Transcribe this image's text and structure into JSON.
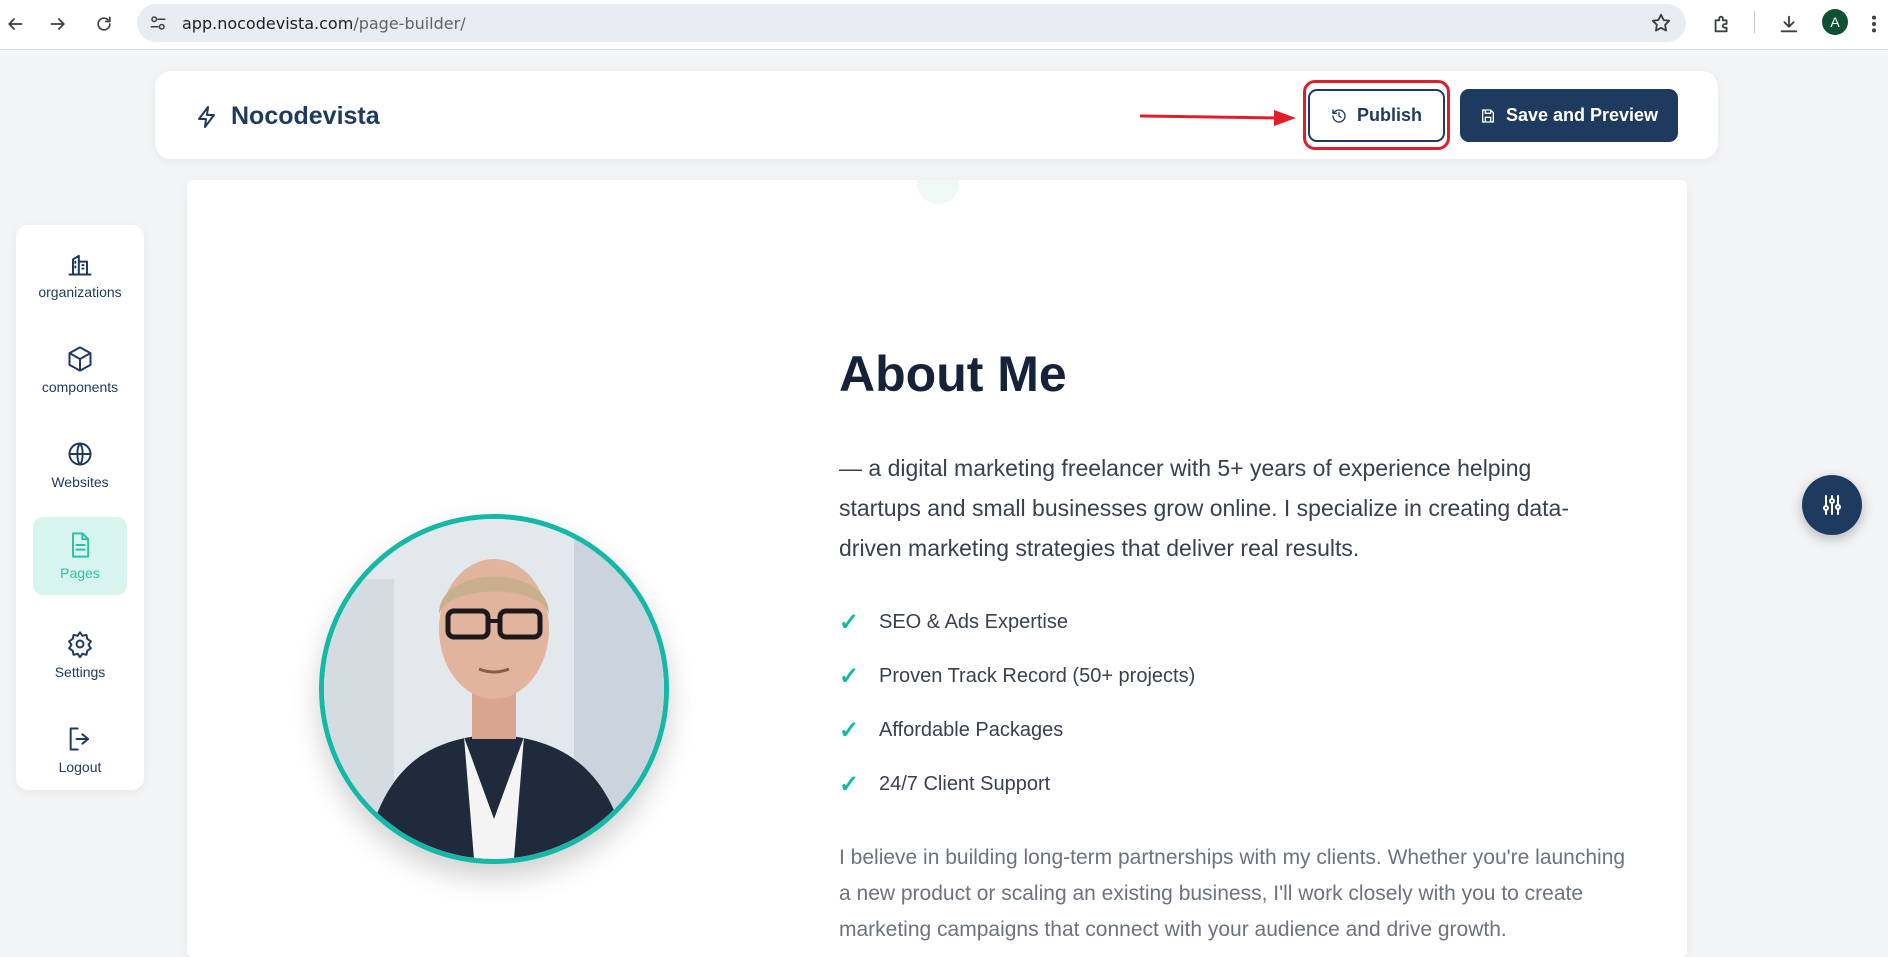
{
  "browser": {
    "url_host": "app.nocodevista.com",
    "url_path": "/page-builder/",
    "profile_initial": "A"
  },
  "header": {
    "brand": "Nocodevista",
    "publish_label": "Publish",
    "save_label": "Save and Preview",
    "annotation_color": "#e11d2a"
  },
  "sidebar": {
    "items": [
      {
        "label": "organizations",
        "icon": "building-icon"
      },
      {
        "label": "components",
        "icon": "cube-icon"
      },
      {
        "label": "Websites",
        "icon": "globe-icon"
      },
      {
        "label": "Pages",
        "icon": "page-icon",
        "active": true
      },
      {
        "label": "Settings",
        "icon": "gear-icon"
      },
      {
        "label": "Logout",
        "icon": "logout-icon"
      }
    ]
  },
  "about": {
    "title": "About Me",
    "lead": "— a digital marketing freelancer with 5+ years of experience helping startups and small businesses grow online. I specialize in creating data-driven marketing strategies that deliver real results.",
    "features": [
      "SEO & Ads Expertise",
      "Proven Track Record (50+ projects)",
      "Affordable Packages",
      "24/7 Client Support"
    ],
    "check_glyph": "✓",
    "body": "I believe in building long-term partnerships with my clients. Whether you're launching a new product or scaling an existing business, I'll work closely with you to create marketing campaigns that connect with your audience and drive growth."
  },
  "colors": {
    "primary": "#1e3a5f",
    "accent": "#14b8a6",
    "active_bg": "#d7f5ee"
  }
}
